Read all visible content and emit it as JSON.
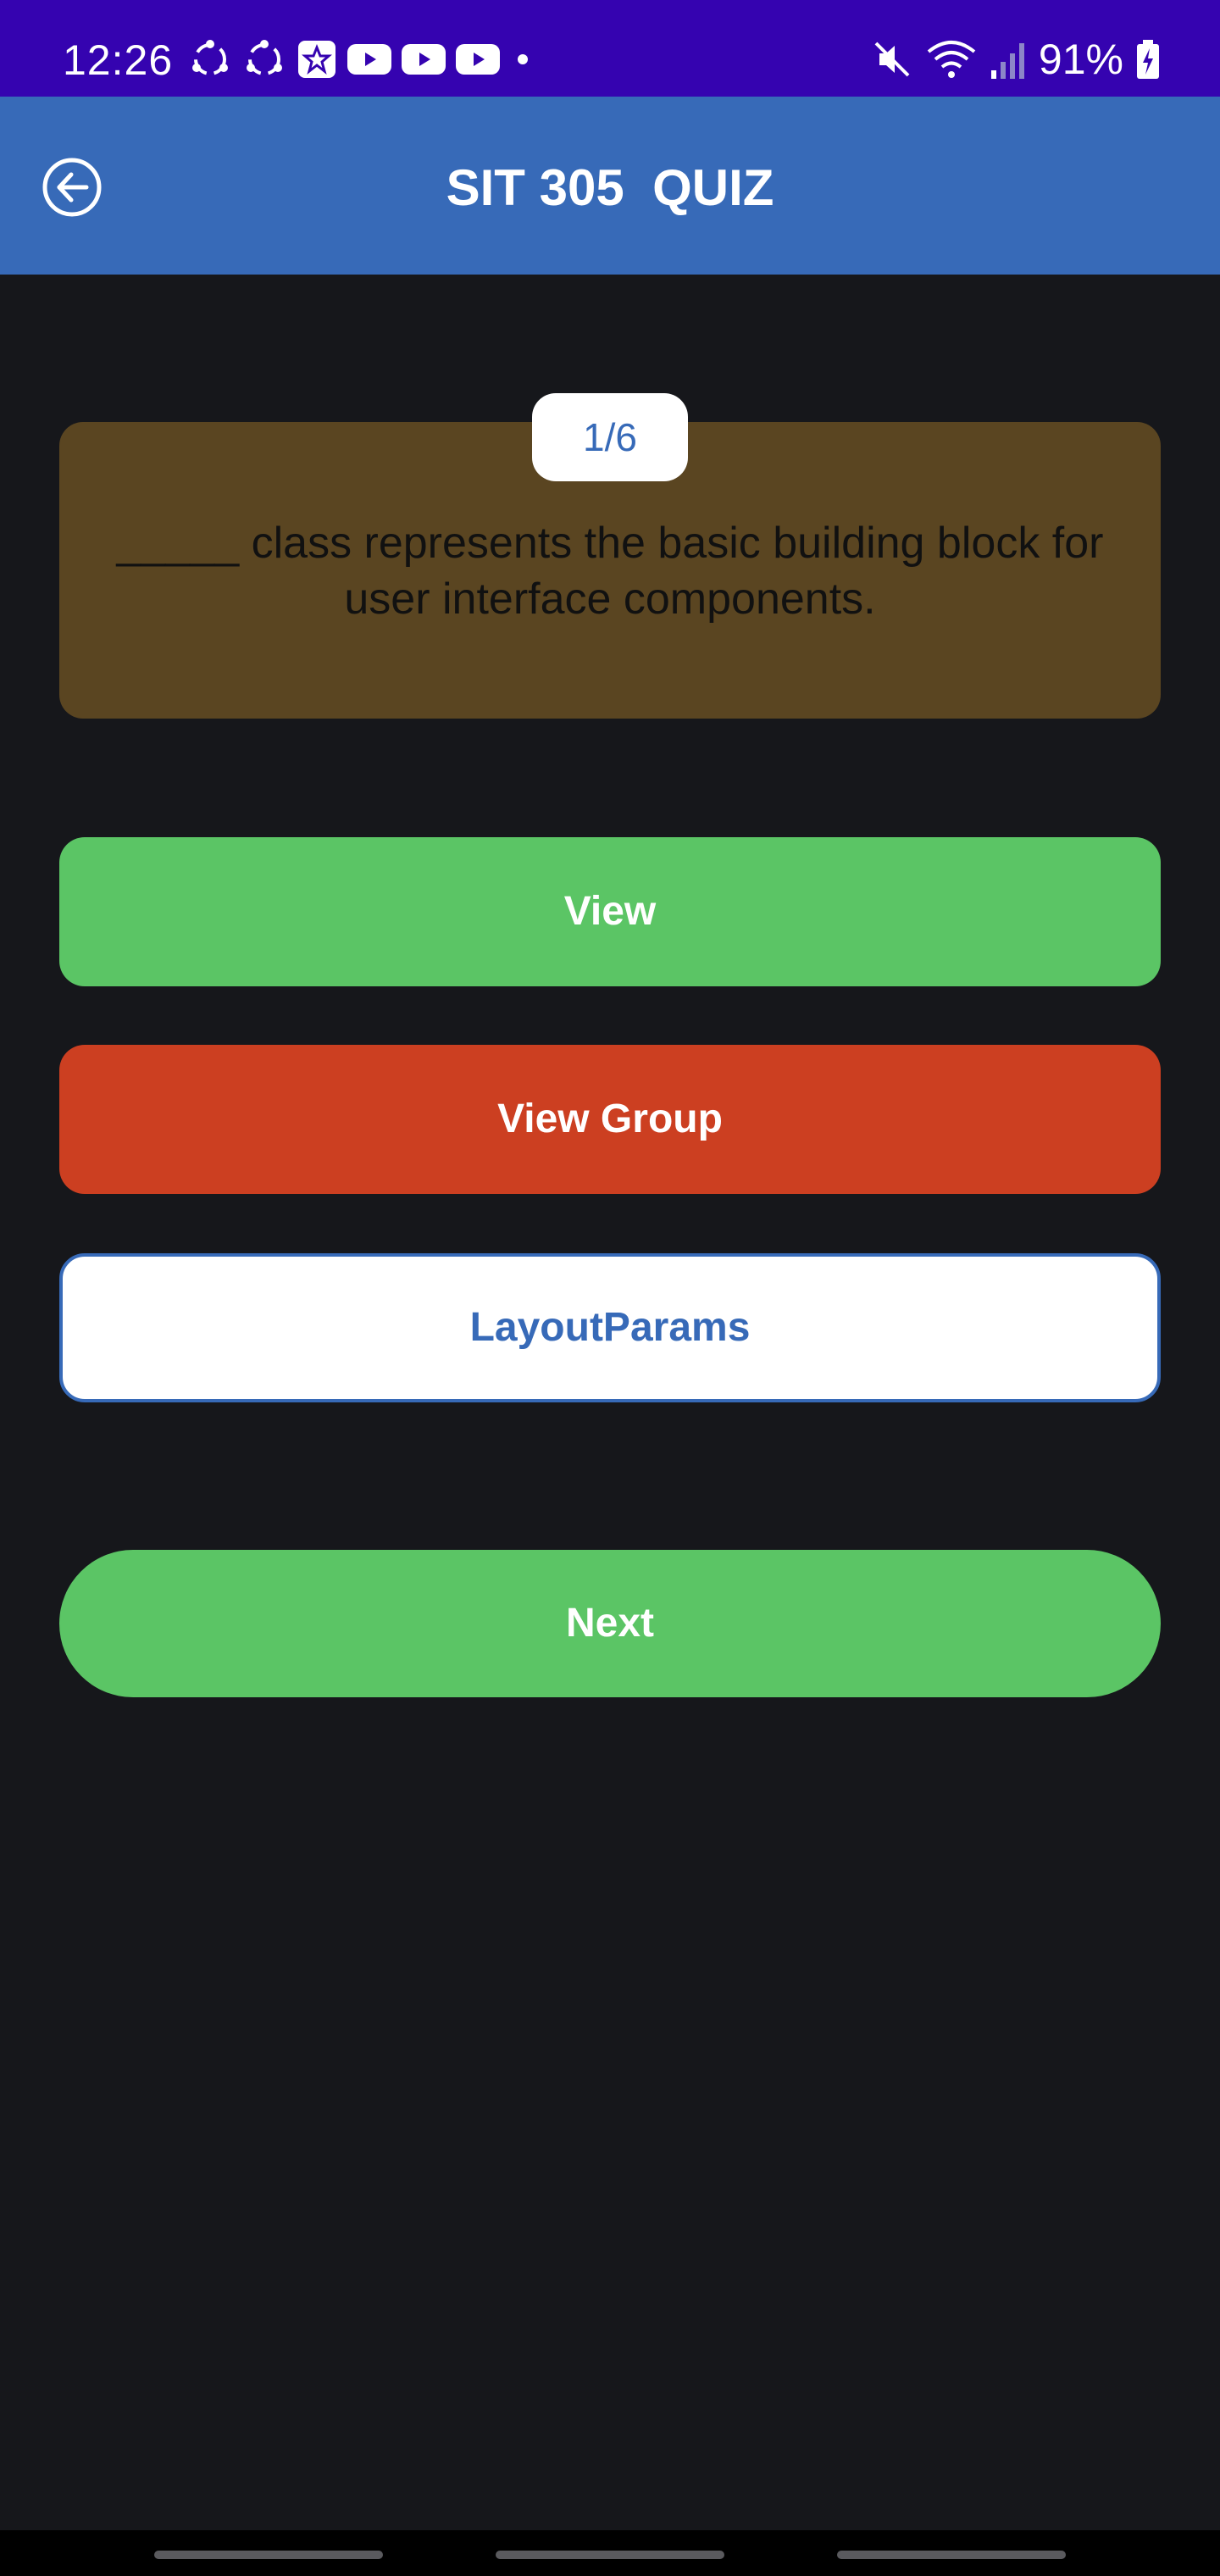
{
  "status_bar": {
    "time": "12:26",
    "battery": "91%",
    "icons": [
      "sync-icon",
      "sync-icon",
      "star-app-icon",
      "youtube-icon",
      "youtube-icon",
      "youtube-icon",
      "dot-icon",
      "mute-icon",
      "wifi-icon",
      "signal-icon",
      "battery-charging-icon"
    ]
  },
  "app_bar": {
    "title": "SIT 305  QUIZ",
    "back_icon": "back-arrow-circle-icon"
  },
  "quiz": {
    "progress": "1/6",
    "question": "_____ class represents the basic building block for user interface components.",
    "options": [
      {
        "label": "View",
        "state": "correct",
        "color": "#5bc565"
      },
      {
        "label": "View Group",
        "state": "selected-wrong",
        "color": "#cc3f21"
      },
      {
        "label": "LayoutParams",
        "state": "default",
        "color": "#ffffff"
      }
    ],
    "next_label": "Next"
  },
  "colors": {
    "status_bar": "#3503b0",
    "app_bar": "#376ab8",
    "background": "#16171b",
    "question_card": "#5a4521",
    "correct": "#5bc565",
    "wrong": "#cc3f21"
  }
}
